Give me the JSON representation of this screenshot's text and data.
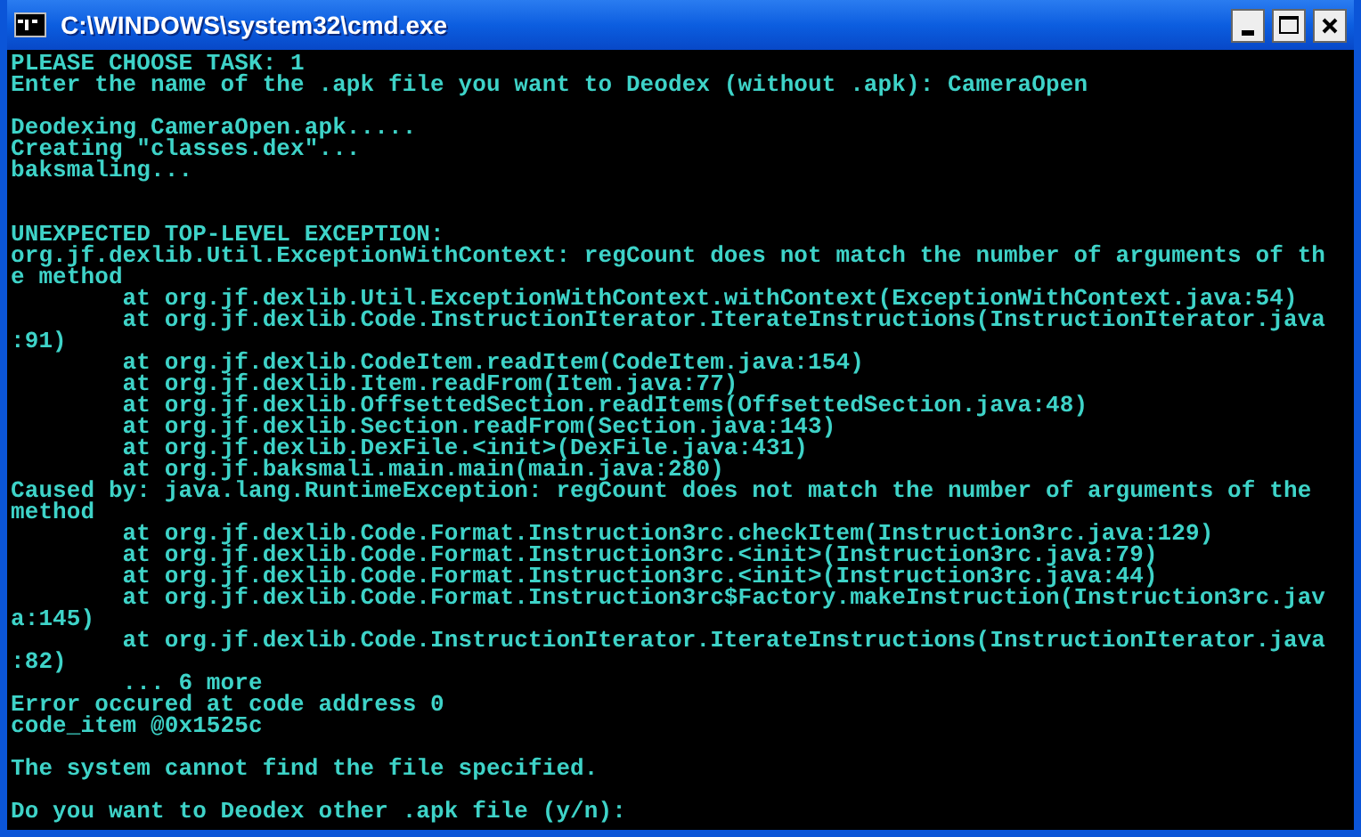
{
  "window": {
    "title": "C:\\WINDOWS\\system32\\cmd.exe"
  },
  "console": {
    "lines": [
      {
        "kind": "text",
        "text": "PLEASE CHOOSE TASK: 1"
      },
      {
        "kind": "text",
        "text": "Enter the name of the .apk file you want to Deodex (without .apk): CameraOpen"
      },
      {
        "kind": "blank"
      },
      {
        "kind": "text",
        "text": "Deodexing CameraOpen.apk....."
      },
      {
        "kind": "text",
        "text": "Creating \"classes.dex\"..."
      },
      {
        "kind": "text",
        "text": "baksmaling..."
      },
      {
        "kind": "blank"
      },
      {
        "kind": "blank"
      },
      {
        "kind": "text",
        "text": "UNEXPECTED TOP-LEVEL EXCEPTION:"
      },
      {
        "kind": "text",
        "text": "org.jf.dexlib.Util.ExceptionWithContext: regCount does not match the number of arguments of th"
      },
      {
        "kind": "text",
        "text": "e method"
      },
      {
        "kind": "text",
        "text": "        at org.jf.dexlib.Util.ExceptionWithContext.withContext(ExceptionWithContext.java:54)"
      },
      {
        "kind": "text",
        "text": "        at org.jf.dexlib.Code.InstructionIterator.IterateInstructions(InstructionIterator.java"
      },
      {
        "kind": "text",
        "text": ":91)"
      },
      {
        "kind": "text",
        "text": "        at org.jf.dexlib.CodeItem.readItem(CodeItem.java:154)"
      },
      {
        "kind": "text",
        "text": "        at org.jf.dexlib.Item.readFrom(Item.java:77)"
      },
      {
        "kind": "text",
        "text": "        at org.jf.dexlib.OffsettedSection.readItems(OffsettedSection.java:48)"
      },
      {
        "kind": "text",
        "text": "        at org.jf.dexlib.Section.readFrom(Section.java:143)"
      },
      {
        "kind": "text",
        "text": "        at org.jf.dexlib.DexFile.<init>(DexFile.java:431)"
      },
      {
        "kind": "text",
        "text": "        at org.jf.baksmali.main.main(main.java:280)"
      },
      {
        "kind": "text",
        "text": "Caused by: java.lang.RuntimeException: regCount does not match the number of arguments of the"
      },
      {
        "kind": "text",
        "text": "method"
      },
      {
        "kind": "text",
        "text": "        at org.jf.dexlib.Code.Format.Instruction3rc.checkItem(Instruction3rc.java:129)"
      },
      {
        "kind": "text",
        "text": "        at org.jf.dexlib.Code.Format.Instruction3rc.<init>(Instruction3rc.java:79)"
      },
      {
        "kind": "text",
        "text": "        at org.jf.dexlib.Code.Format.Instruction3rc.<init>(Instruction3rc.java:44)"
      },
      {
        "kind": "text",
        "text": "        at org.jf.dexlib.Code.Format.Instruction3rc$Factory.makeInstruction(Instruction3rc.jav"
      },
      {
        "kind": "text",
        "text": "a:145)"
      },
      {
        "kind": "text",
        "text": "        at org.jf.dexlib.Code.InstructionIterator.IterateInstructions(InstructionIterator.java"
      },
      {
        "kind": "text",
        "text": ":82)"
      },
      {
        "kind": "text",
        "text": "        ... 6 more"
      },
      {
        "kind": "text",
        "text": "Error occured at code address 0"
      },
      {
        "kind": "text",
        "text": "code_item @0x1525c"
      },
      {
        "kind": "blank"
      },
      {
        "kind": "text",
        "text": "The system cannot find the file specified."
      },
      {
        "kind": "blank"
      },
      {
        "kind": "text",
        "text": "Do you want to Deodex other .apk file (y/n):"
      }
    ]
  }
}
